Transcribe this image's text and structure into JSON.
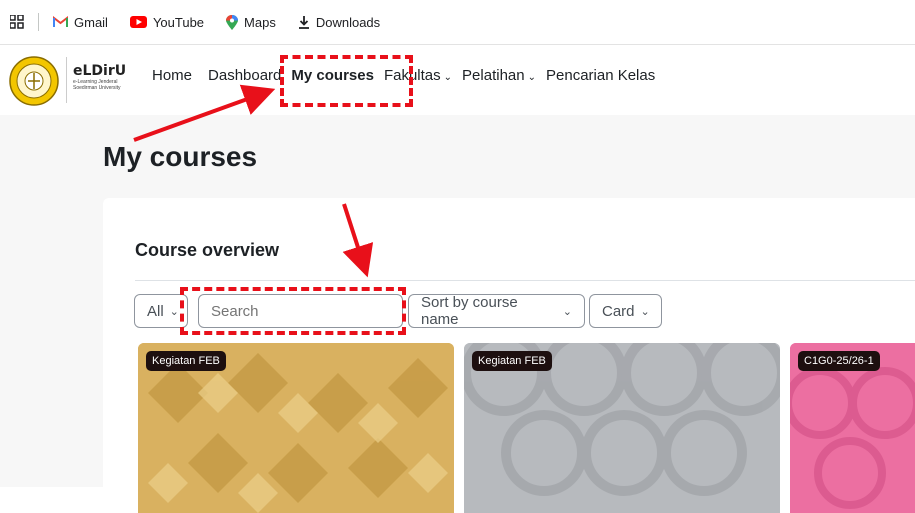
{
  "bookmarks": [
    {
      "icon": "gmail-icon",
      "label": "Gmail"
    },
    {
      "icon": "youtube-icon",
      "label": "YouTube"
    },
    {
      "icon": "maps-icon",
      "label": "Maps"
    },
    {
      "icon": "download-icon",
      "label": "Downloads"
    }
  ],
  "brand": {
    "name": "eLDirU",
    "subtitle": "e-Learning Jenderal Soedirman University"
  },
  "nav": {
    "home": "Home",
    "dashboard": "Dashboard",
    "my_courses": "My courses",
    "fakultas": "Fakultas",
    "pelatihan": "Pelatihan",
    "pencarian": "Pencarian Kelas"
  },
  "page": {
    "title": "My courses"
  },
  "overview": {
    "title": "Course overview",
    "filter": "All",
    "search_placeholder": "Search",
    "sort": "Sort by course name",
    "view": "Card"
  },
  "cards": [
    {
      "badge": "Kegiatan FEB"
    },
    {
      "badge": "Kegiatan FEB"
    },
    {
      "badge": "C1G0-25/26-1"
    }
  ],
  "colors": {
    "annotation": "#e8101a",
    "accent": "#1d2125"
  }
}
